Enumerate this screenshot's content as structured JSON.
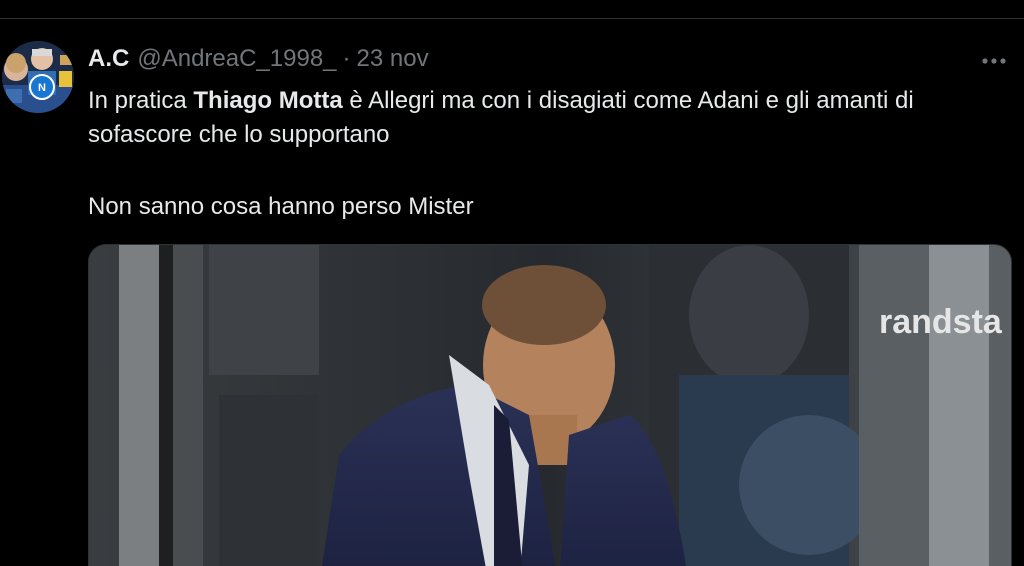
{
  "tweet": {
    "display_name": "A.C",
    "handle": "@AndreaC_1998_",
    "separator": "·",
    "date": "23 nov",
    "text": {
      "line1_prefix": "In pratica ",
      "line1_bold": "Thiago Motta",
      "line1_suffix": " è Allegri ma con i disagiati come Adani e gli amanti di sofascore che lo supportano",
      "line2": "Non sanno cosa hanno perso Mister"
    },
    "media": {
      "sponsor_text": "randsta"
    }
  },
  "icons": {
    "more": "more-horizontal-icon",
    "avatar": "avatar"
  },
  "colors": {
    "background": "#000000",
    "primary_text": "#e7e9ea",
    "secondary_text": "#71767b",
    "divider": "#2f3336"
  }
}
